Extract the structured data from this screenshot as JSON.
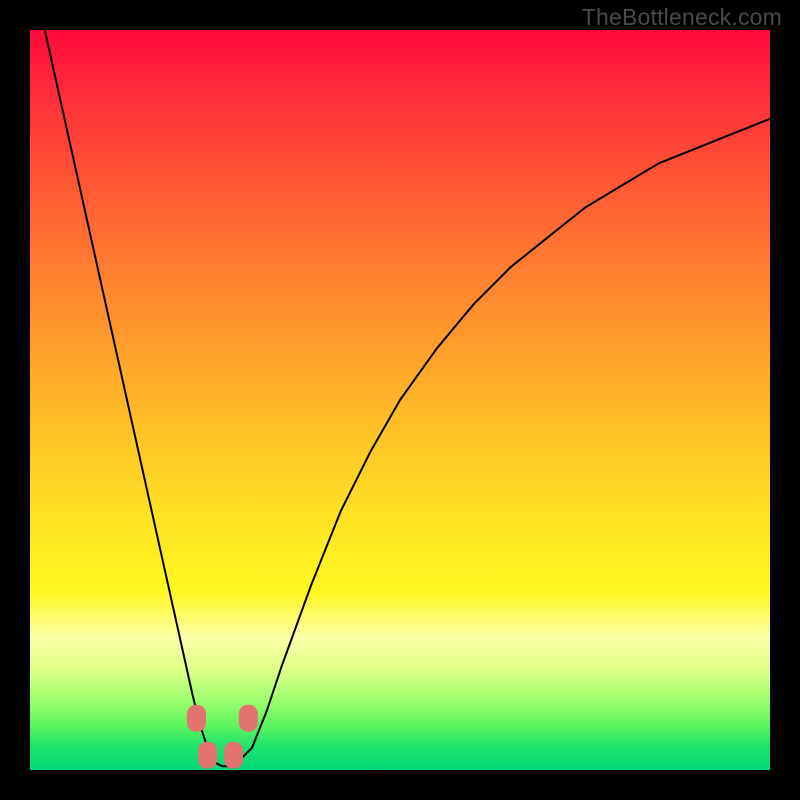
{
  "watermark": "TheBottleneck.com",
  "chart_data": {
    "type": "line",
    "title": "",
    "xlabel": "",
    "ylabel": "",
    "xlim": [
      0,
      100
    ],
    "ylim": [
      0,
      100
    ],
    "grid": false,
    "series": [
      {
        "name": "bottleneck-curve",
        "x": [
          2,
          4,
          6,
          8,
          10,
          12,
          14,
          16,
          18,
          20,
          22,
          23,
          24,
          25,
          26,
          27,
          28,
          30,
          32,
          34,
          38,
          42,
          46,
          50,
          55,
          60,
          65,
          70,
          75,
          80,
          85,
          90,
          95,
          100
        ],
        "values": [
          100,
          91,
          82,
          73,
          64,
          55,
          46,
          37,
          28,
          19,
          10,
          6,
          3,
          1,
          0.5,
          0.5,
          1,
          3,
          8,
          14,
          25,
          35,
          43,
          50,
          57,
          63,
          68,
          72,
          76,
          79,
          82,
          84,
          86,
          88
        ]
      }
    ],
    "markers": [
      {
        "name": "left-upper",
        "x": 22.5,
        "y": 7
      },
      {
        "name": "left-lower",
        "x": 24.0,
        "y": 2.0
      },
      {
        "name": "right-lower",
        "x": 27.5,
        "y": 2.0
      },
      {
        "name": "right-upper",
        "x": 29.5,
        "y": 7
      }
    ]
  },
  "colors": {
    "marker": "#e2736e",
    "curve": "#000000"
  }
}
